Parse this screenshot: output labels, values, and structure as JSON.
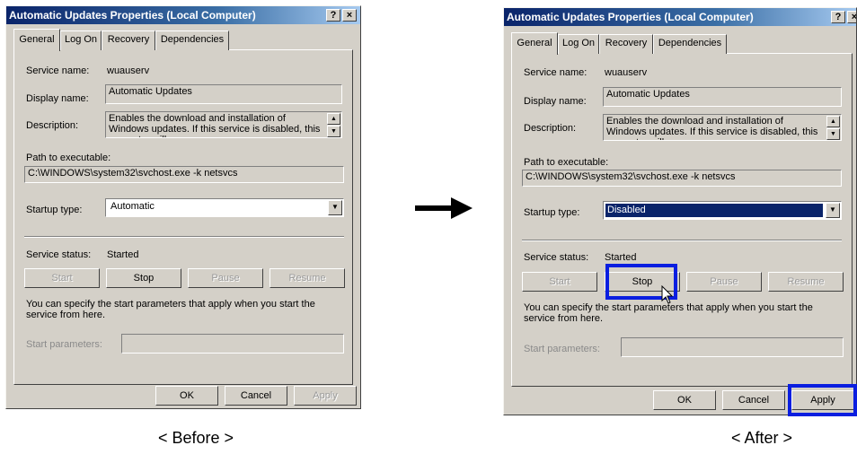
{
  "before": {
    "title": "Automatic Updates Properties (Local Computer)",
    "title_buttons": [
      "?",
      "×"
    ],
    "tabs": [
      "General",
      "Log On",
      "Recovery",
      "Dependencies"
    ],
    "service_name_label": "Service name:",
    "service_name_value": "wuauserv",
    "display_name_label": "Display name:",
    "display_name_value": "Automatic Updates",
    "description_label": "Description:",
    "description_value": "Enables the download and installation of Windows updates. If this service is disabled, this computer will",
    "path_label": "Path to executable:",
    "path_value": "C:\\WINDOWS\\system32\\svchost.exe -k netsvcs",
    "startup_type_label": "Startup type:",
    "startup_type_value": "Automatic",
    "service_status_label": "Service status:",
    "service_status_value": "Started",
    "buttons": {
      "start": "Start",
      "stop": "Stop",
      "pause": "Pause",
      "resume": "Resume"
    },
    "hint": "You can specify the start parameters that apply when you start the service from here.",
    "start_params_label": "Start parameters:",
    "footer": {
      "ok": "OK",
      "cancel": "Cancel",
      "apply": "Apply"
    }
  },
  "after": {
    "title": "Automatic Updates Properties (Local Computer)",
    "title_buttons": [
      "?",
      "×"
    ],
    "tabs": [
      "General",
      "Log On",
      "Recovery",
      "Dependencies"
    ],
    "service_name_label": "Service name:",
    "service_name_value": "wuauserv",
    "display_name_label": "Display name:",
    "display_name_value": "Automatic Updates",
    "description_label": "Description:",
    "description_value": "Enables the download and installation of Windows updates. If this service is disabled, this computer will",
    "path_label": "Path to executable:",
    "path_value": "C:\\WINDOWS\\system32\\svchost.exe -k netsvcs",
    "startup_type_label": "Startup type:",
    "startup_type_value": "Disabled",
    "service_status_label": "Service status:",
    "service_status_value": "Started",
    "buttons": {
      "start": "Start",
      "stop": "Stop",
      "pause": "Pause",
      "resume": "Resume"
    },
    "hint": "You can specify the start parameters that apply when you start the service from here.",
    "start_params_label": "Start parameters:",
    "footer": {
      "ok": "OK",
      "cancel": "Cancel",
      "apply": "Apply"
    }
  },
  "captions": {
    "before": "< Before >",
    "after": "< After >"
  },
  "icons": {
    "arrow": "right-arrow-icon",
    "cursor": "mouse-pointer-icon",
    "dropdown": "chevron-down-icon"
  },
  "colors": {
    "highlight_box": "#0a1ee0",
    "title_bar": "#0a246a",
    "dialog_face": "#d4d0c8"
  }
}
